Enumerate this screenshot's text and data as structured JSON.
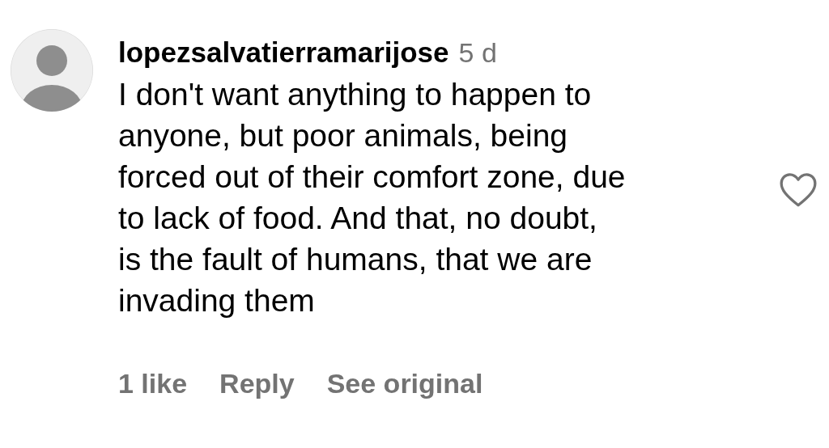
{
  "comment": {
    "username": "lopezsalvatierramarijose",
    "time": "5 d",
    "text_lines": [
      "I don't want anything to happen to",
      "anyone, but poor animals, being",
      "forced out of their comfort zone, due",
      "to lack of food. And that, no doubt,",
      "is the fault of humans, that we are",
      "invading them"
    ],
    "liked": false,
    "likes": "1 like",
    "reply": "Reply",
    "see_original": "See original"
  }
}
